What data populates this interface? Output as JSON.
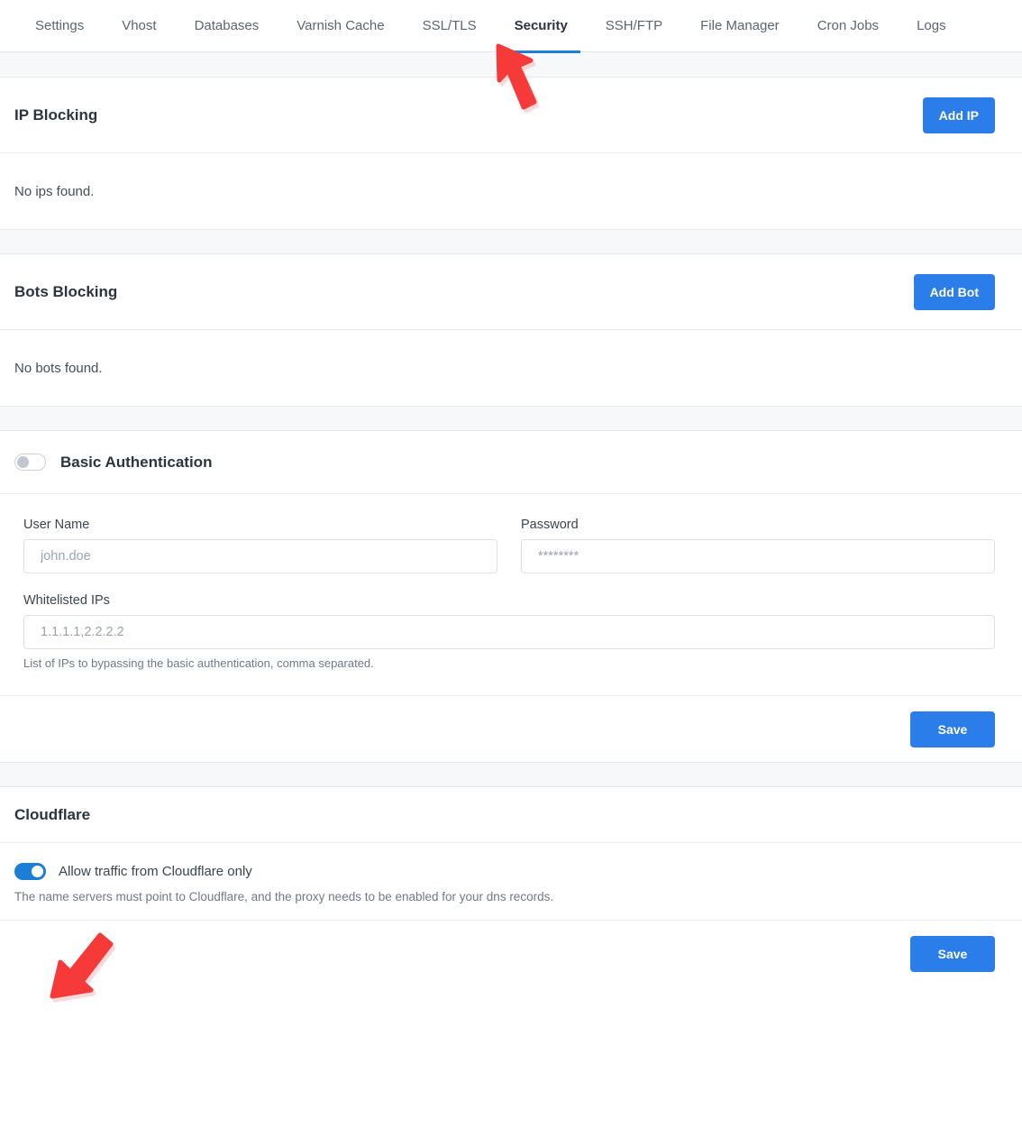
{
  "tabs": [
    {
      "label": "Settings",
      "active": false
    },
    {
      "label": "Vhost",
      "active": false
    },
    {
      "label": "Databases",
      "active": false
    },
    {
      "label": "Varnish Cache",
      "active": false
    },
    {
      "label": "SSL/TLS",
      "active": false
    },
    {
      "label": "Security",
      "active": true
    },
    {
      "label": "SSH/FTP",
      "active": false
    },
    {
      "label": "File Manager",
      "active": false
    },
    {
      "label": "Cron Jobs",
      "active": false
    },
    {
      "label": "Logs",
      "active": false
    }
  ],
  "ip_blocking": {
    "title": "IP Blocking",
    "add_button": "Add IP",
    "empty_text": "No ips found."
  },
  "bots_blocking": {
    "title": "Bots Blocking",
    "add_button": "Add Bot",
    "empty_text": "No bots found."
  },
  "basic_auth": {
    "title": "Basic Authentication",
    "enabled": false,
    "username": {
      "label": "User Name",
      "value": "",
      "placeholder": "john.doe"
    },
    "password": {
      "label": "Password",
      "value": "",
      "placeholder": "********"
    },
    "whitelisted_ips": {
      "label": "Whitelisted IPs",
      "value": "",
      "placeholder": "1.1.1.1,2.2.2.2",
      "help": "List of IPs to bypassing the basic authentication, comma separated."
    },
    "save_label": "Save"
  },
  "cloudflare": {
    "title": "Cloudflare",
    "toggle_label": "Allow traffic from Cloudflare only",
    "enabled": true,
    "help": "The name servers must point to Cloudflare, and the proxy needs to be enabled for your dns records.",
    "save_label": "Save"
  },
  "colors": {
    "accent_blue": "#2b7de9",
    "tab_underline": "#1c7ed6",
    "annotation_red": "#f63a3a",
    "band_gray": "#f6f8fa"
  },
  "annotations": [
    {
      "name": "arrow-pointing-to-security-tab",
      "direction": "up-left"
    },
    {
      "name": "arrow-pointing-to-cloudflare-toggle",
      "direction": "down-left"
    }
  ]
}
